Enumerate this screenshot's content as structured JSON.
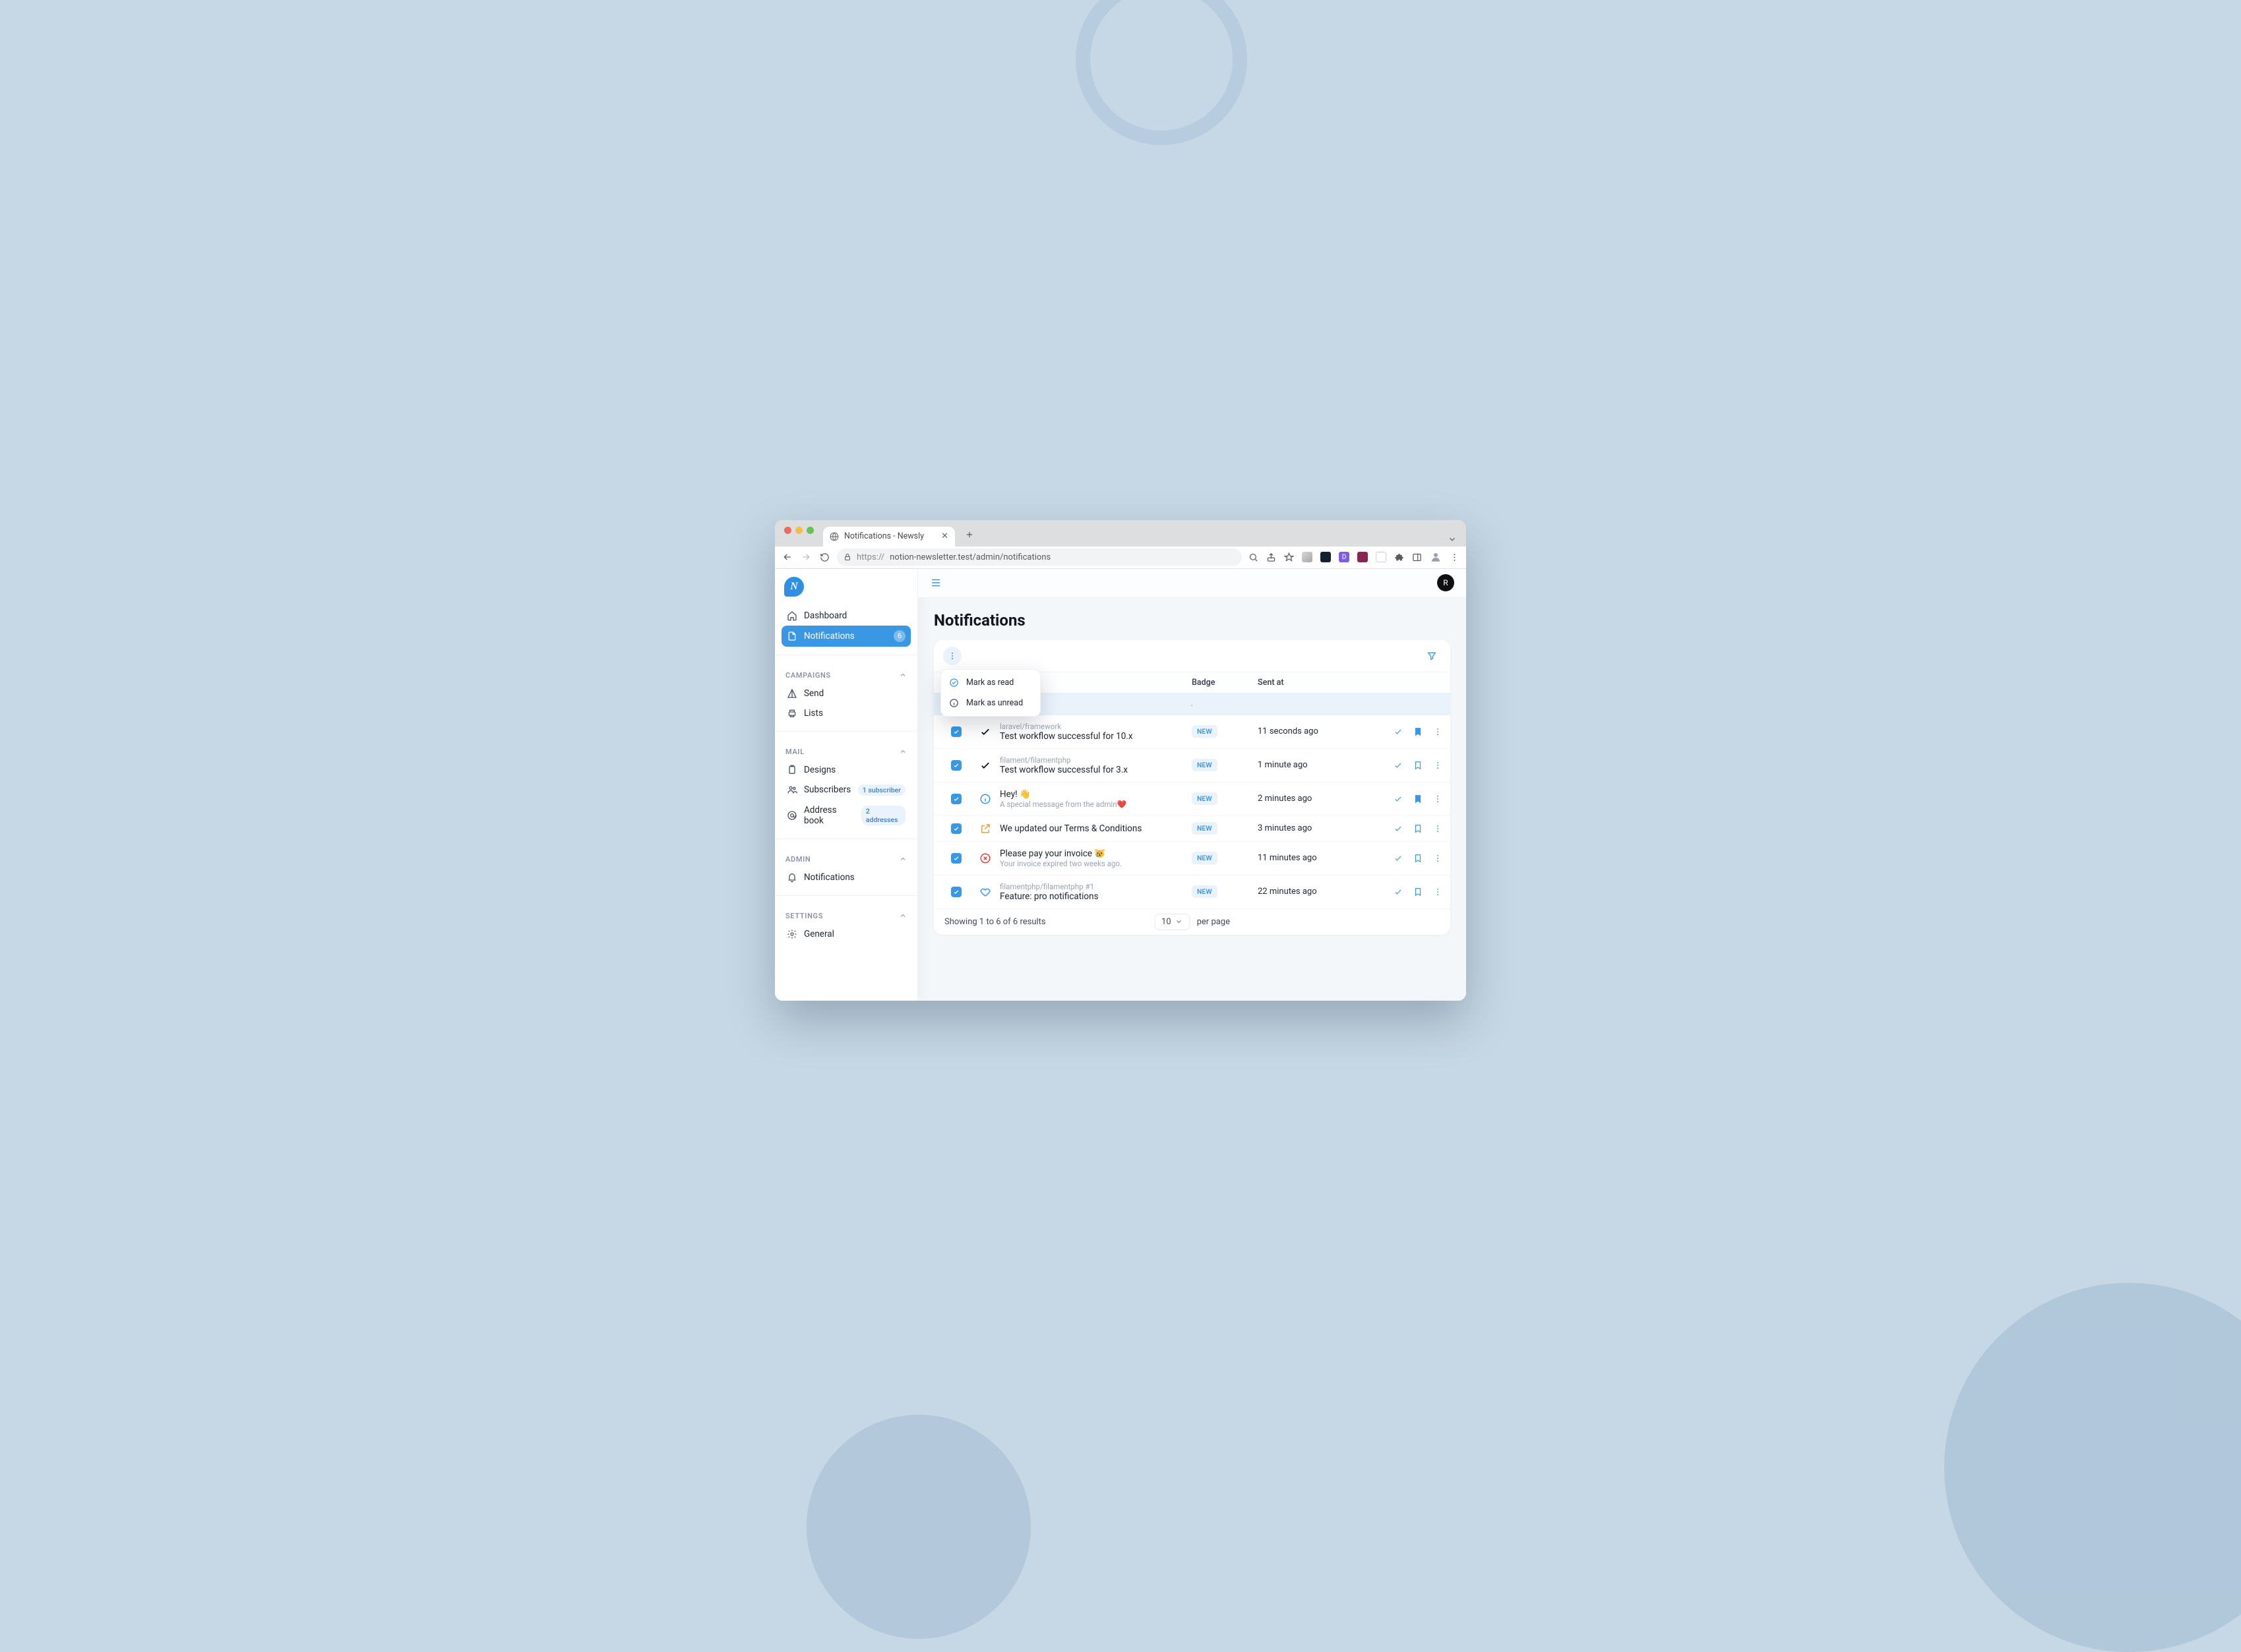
{
  "browser": {
    "tab_title": "Notifications - Newsly",
    "url_protocol": "https://",
    "url_rest": "notion-newsletter.test/admin/notifications"
  },
  "brand": {
    "letter": "N"
  },
  "avatar_letter": "R",
  "sidebar": {
    "top": [
      {
        "label": "Dashboard"
      },
      {
        "label": "Notifications",
        "badge": "6"
      }
    ],
    "sections": [
      {
        "heading": "CAMPAIGNS",
        "items": [
          {
            "label": "Send"
          },
          {
            "label": "Lists"
          }
        ]
      },
      {
        "heading": "MAIL",
        "items": [
          {
            "label": "Designs"
          },
          {
            "label": "Subscribers",
            "pill": "1 subscriber"
          },
          {
            "label": "Address book",
            "pill": "2 addresses"
          }
        ]
      },
      {
        "heading": "ADMIN",
        "items": [
          {
            "label": "Notifications"
          }
        ]
      },
      {
        "heading": "SETTINGS",
        "items": [
          {
            "label": "General"
          }
        ]
      }
    ]
  },
  "page": {
    "title": "Notifications"
  },
  "bulk_menu": {
    "read": "Mark as read",
    "unread": "Mark as unread"
  },
  "columns": {
    "badge": "Badge",
    "sent": "Sent at"
  },
  "select_banner_suffix": ".",
  "rows": [
    {
      "from": "laravel/framework",
      "title": "Test workflow successful for 10.x",
      "sub": "",
      "badge": "NEW",
      "sent": "11 seconds ago",
      "icon": "check",
      "saved": true
    },
    {
      "from": "filament/filamentphp",
      "title": "Test workflow successful for 3.x",
      "sub": "",
      "badge": "NEW",
      "sent": "1 minute ago",
      "icon": "check",
      "saved": false
    },
    {
      "from": "",
      "title": "Hey! 👋",
      "sub": "A special message from the admin❤️",
      "badge": "NEW",
      "sent": "2 minutes ago",
      "icon": "info",
      "saved": true
    },
    {
      "from": "",
      "title": "We updated our Terms & Conditions",
      "sub": "",
      "badge": "NEW",
      "sent": "3 minutes ago",
      "icon": "external",
      "saved": false
    },
    {
      "from": "",
      "title": "Please pay your invoice 😿",
      "sub": "Your invoice expired two weeks ago.",
      "badge": "NEW",
      "sent": "11 minutes ago",
      "icon": "xcircle",
      "saved": false
    },
    {
      "from": "filamentphp/filamentphp #1",
      "title": "Feature: pro notifications",
      "sub": "",
      "badge": "NEW",
      "sent": "22 minutes ago",
      "icon": "heart",
      "saved": false
    }
  ],
  "footer": {
    "showing": "Showing 1 to 6 of 6 results",
    "per_page_value": "10",
    "per_page_label": "per page"
  }
}
